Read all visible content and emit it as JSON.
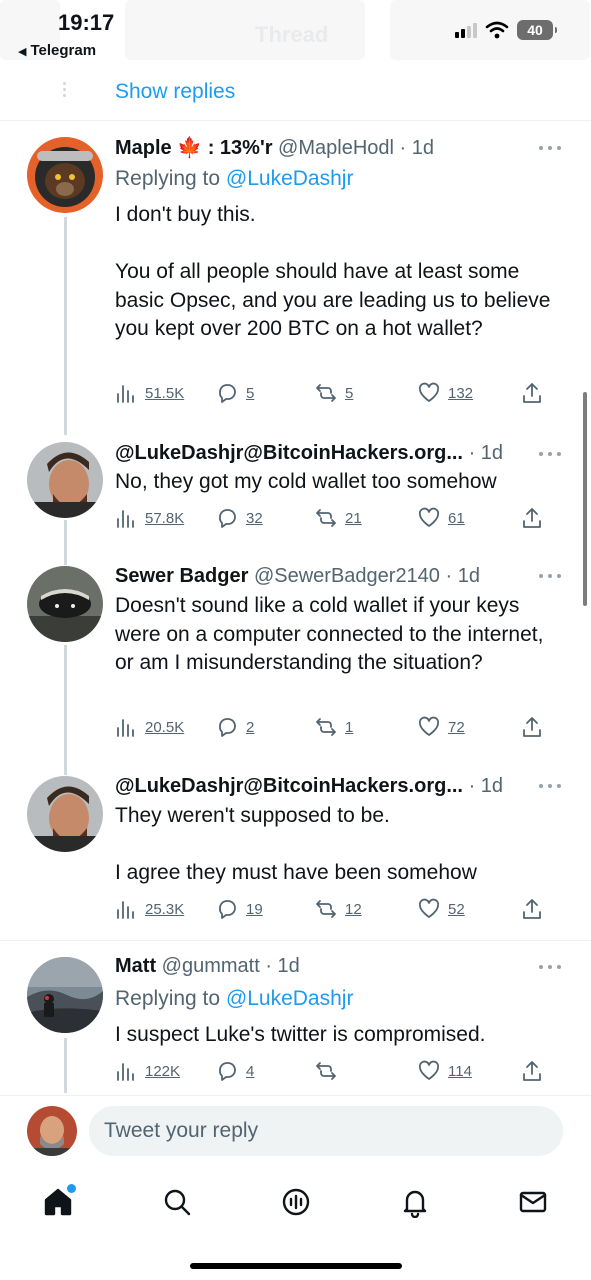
{
  "status_bar": {
    "time": "19:17",
    "back_label": "Telegram",
    "ghost_title": "Thread",
    "battery": "40"
  },
  "show_replies": "Show replies",
  "tweets": [
    {
      "name": "Maple 🍁 : 13%'r",
      "handle": "@MapleHodl",
      "time": "· 1d",
      "replying_prefix": "Replying to",
      "replying_to": "@LukeDashjr",
      "text": "I don't buy this.\n\nYou of all people should have at least some basic Opsec, and you are leading us to believe you kept over 200 BTC on a hot wallet?",
      "views": "51.5K",
      "replies": "5",
      "retweets": "5",
      "likes": "132"
    },
    {
      "name": "@LukeDashjr@BitcoinHackers.org...",
      "handle": "",
      "time": "· 1d",
      "text": "No, they got my cold wallet too somehow",
      "views": "57.8K",
      "replies": "32",
      "retweets": "21",
      "likes": "61"
    },
    {
      "name": "Sewer Badger",
      "handle": "@SewerBadger2140",
      "time": "· 1d",
      "text": "Doesn't sound like a cold wallet if your keys were on a computer connected to the internet, or am I misunderstanding the situation?",
      "views": "20.5K",
      "replies": "2",
      "retweets": "1",
      "likes": "72"
    },
    {
      "name": "@LukeDashjr@BitcoinHackers.org...",
      "handle": "",
      "time": "· 1d",
      "text": "They weren't supposed to be.\n\nI agree they must have been somehow",
      "views": "25.3K",
      "replies": "19",
      "retweets": "12",
      "likes": "52"
    },
    {
      "name": "Matt",
      "handle": "@gummatt",
      "time": "· 1d",
      "replying_prefix": "Replying to",
      "replying_to": "@LukeDashjr",
      "text": "I suspect Luke's twitter is compromised.",
      "views": "122K",
      "replies": "4",
      "retweets": "",
      "likes": "114"
    }
  ],
  "reply_bar": {
    "placeholder": "Tweet your reply"
  },
  "nav": {
    "items": [
      "home-icon",
      "search-icon",
      "spaces-icon",
      "notifications-icon",
      "messages-icon"
    ],
    "accent": "#1d9bf0"
  },
  "colors": {
    "link": "#1d9bf0",
    "secondary": "#536471",
    "text": "#0f1419"
  }
}
